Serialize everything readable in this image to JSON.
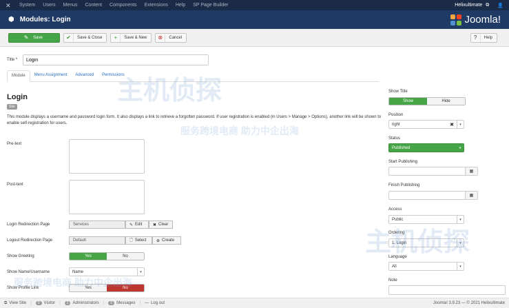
{
  "topbar": {
    "menu": [
      "System",
      "Users",
      "Menus",
      "Content",
      "Components",
      "Extensions",
      "Help",
      "SP Page Builder"
    ],
    "user_link": "Helixultimate",
    "external_icon": "external-link-icon",
    "user_icon": "user-icon"
  },
  "header": {
    "title": "Modules: Login",
    "brand": "Joomla!"
  },
  "toolbar": {
    "save": "Save",
    "save_close": "Save & Close",
    "save_new": "Save & New",
    "cancel": "Cancel",
    "help": "Help"
  },
  "form": {
    "title_label": "Title *",
    "title_value": "Login",
    "tabs": [
      "Module",
      "Menu Assignment",
      "Advanced",
      "Permissions"
    ],
    "module_title": "Login",
    "site_badge": "Site",
    "description": "This module displays a username and password login form. It also displays a link to retrieve a forgotten password. If user registration is enabled (in Users > Manage > Options), another link will be shown to enable self-registration for users.",
    "pretext_label": "Pre-text",
    "posttext_label": "Post-text",
    "login_redirect_label": "Login Redirection Page",
    "login_redirect_value": "Services",
    "edit_label": "Edit",
    "clear_label": "Clear",
    "logout_redirect_label": "Logout Redirection Page",
    "logout_redirect_value": "Default",
    "select_label": "Select",
    "create_label": "Create",
    "show_greeting_label": "Show Greeting",
    "yes": "Yes",
    "no": "No",
    "show_name_label": "Show Name/Username",
    "show_name_value": "Name",
    "show_profile_label": "Show Profile Link"
  },
  "sidebar": {
    "show_title_label": "Show Title",
    "show": "Show",
    "hide": "Hide",
    "position_label": "Position",
    "position_value": "right",
    "status_label": "Status",
    "status_value": "Published",
    "start_publishing_label": "Start Publishing",
    "finish_publishing_label": "Finish Publishing",
    "access_label": "Access",
    "access_value": "Public",
    "ordering_label": "Ordering",
    "ordering_value": "1. Login",
    "language_label": "Language",
    "language_value": "All",
    "note_label": "Note"
  },
  "statusbar": {
    "view_site": "View Site",
    "visitors_count": "0",
    "visitors": "Visitor",
    "admins_count": "2",
    "admins": "Administrators",
    "messages_count": "0",
    "messages": "Messages",
    "logout": "Log out",
    "version": "Joomla! 3.9.23 — © 2021 Helixultimate"
  },
  "watermark": {
    "cn_big": "主机侦探",
    "cn_sub": "服务跨境电商 助力中企出海"
  },
  "colors": {
    "topbar": "#1b2b47",
    "header": "#1f3a64",
    "accent_green": "#46a546",
    "danger_red": "#bd362f"
  }
}
